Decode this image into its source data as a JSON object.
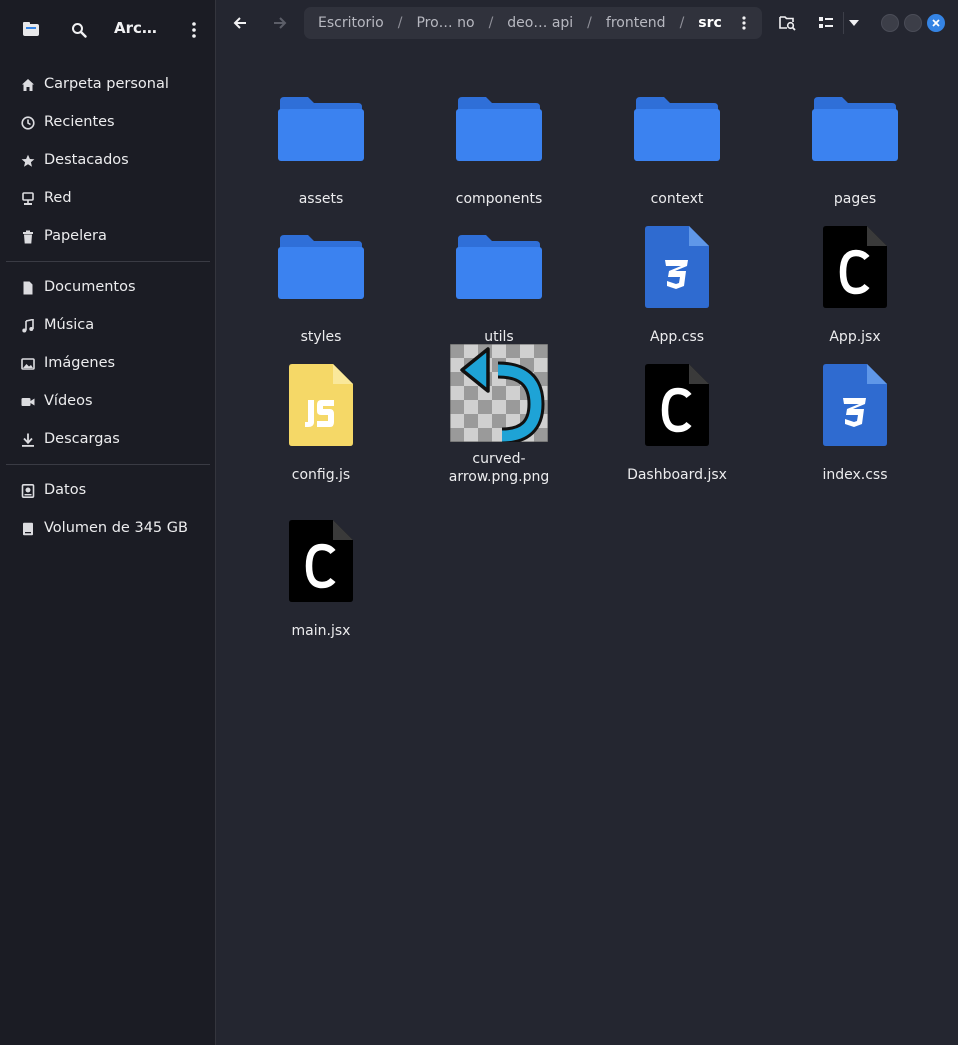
{
  "sidebar": {
    "app_title": "Arc…",
    "places": [
      {
        "label": "Carpeta personal",
        "icon": "home-icon"
      },
      {
        "label": "Recientes",
        "icon": "clock-icon"
      },
      {
        "label": "Destacados",
        "icon": "star-icon"
      },
      {
        "label": "Red",
        "icon": "network-icon"
      },
      {
        "label": "Papelera",
        "icon": "trash-icon"
      }
    ],
    "bookmarks": [
      {
        "label": "Documentos",
        "icon": "document-icon"
      },
      {
        "label": "Música",
        "icon": "music-icon"
      },
      {
        "label": "Imágenes",
        "icon": "image-icon"
      },
      {
        "label": "Vídeos",
        "icon": "video-icon"
      },
      {
        "label": "Descargas",
        "icon": "download-icon"
      }
    ],
    "devices": [
      {
        "label": "Datos",
        "icon": "disk-icon"
      },
      {
        "label": "Volumen de 345 GB",
        "icon": "drive-icon"
      }
    ]
  },
  "pathbar": {
    "crumbs": [
      "Escritorio",
      "Pro… no",
      "deo… api",
      "frontend",
      "src"
    ]
  },
  "files": [
    {
      "name": "assets",
      "type": "folder"
    },
    {
      "name": "components",
      "type": "folder"
    },
    {
      "name": "context",
      "type": "folder"
    },
    {
      "name": "pages",
      "type": "folder"
    },
    {
      "name": "styles",
      "type": "folder"
    },
    {
      "name": "utils",
      "type": "folder"
    },
    {
      "name": "App.css",
      "type": "css"
    },
    {
      "name": "App.jsx",
      "type": "jsx"
    },
    {
      "name": "config.js",
      "type": "js"
    },
    {
      "name": "curved-arrow.png.png",
      "type": "image"
    },
    {
      "name": "Dashboard.jsx",
      "type": "jsx"
    },
    {
      "name": "index.css",
      "type": "css"
    },
    {
      "name": "main.jsx",
      "type": "jsx"
    }
  ],
  "colors": {
    "accent": "#3584e4",
    "folder": "#3b82f0",
    "css_file": "#2f6bd0",
    "js_file": "#f5d867",
    "jsx_file": "#000000"
  }
}
